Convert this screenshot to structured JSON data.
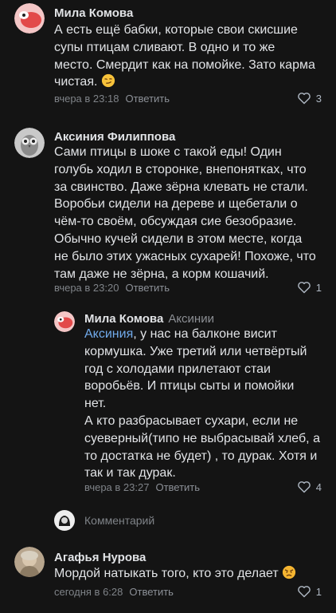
{
  "comments": [
    {
      "author": "Мила Комова",
      "lines": [
        "А есть ещё бабки, которые свои скисшие",
        "супы птицам сливают. В одно и то же",
        "место. Смердит как на помойке. Зато карма",
        "чистая."
      ],
      "emoji": "smirk-emoji",
      "time": "вчера в 23:18",
      "reply_label": "Ответить",
      "likes": "3"
    },
    {
      "author": "Аксиния Филиппова",
      "lines": [
        "Сами птицы в шоке с такой еды! Один",
        "голубь ходил в сторонке, внепонятках, что",
        "за свинство. Даже зёрна клевать не стали.",
        "Воробьи сидели на дереве и щебетали о",
        "чём-то своём, обсуждая сие безобразие.",
        "Обычно кучей сидели в этом месте, когда",
        "не было этих ужасных сухарей! Похоже, что",
        "там даже не зёрна, а корм кошачий."
      ],
      "time": "вчера в 23:20",
      "reply_label": "Ответить",
      "likes": "1"
    },
    {
      "author": "Мила Комова",
      "reply_to": "Аксинии",
      "mention": "Аксиния",
      "lines": [
        ", у нас на балконе висит",
        "кормушка. Уже третий или четвёртый",
        "год с холодами прилетают стаи",
        "воробьёв. И птицы сыты и помойки",
        "нет.",
        "А кто разбрасывает сухари, если не",
        "суеверный(типо не выбрасывай хлеб, а",
        "то достатка не будет) , то дурак. Хотя и",
        "так и так дурак."
      ],
      "time": "вчера в 23:27",
      "reply_label": "Ответить",
      "likes": "4"
    },
    {
      "author": "Агафья Нурова",
      "lines": [
        "Мордой натыкать того, кто это делает"
      ],
      "emoji": "angry-emoji",
      "time": "сегодня в 6:28",
      "reply_label": "Ответить",
      "likes": "1"
    }
  ],
  "comment_box": {
    "placeholder": "Комментарий"
  },
  "icons": {
    "like": "heart-icon"
  },
  "colors": {
    "background": "#141414",
    "text": "#e1e3e6",
    "mention": "#71aaeb",
    "meta": "#7f8388"
  }
}
